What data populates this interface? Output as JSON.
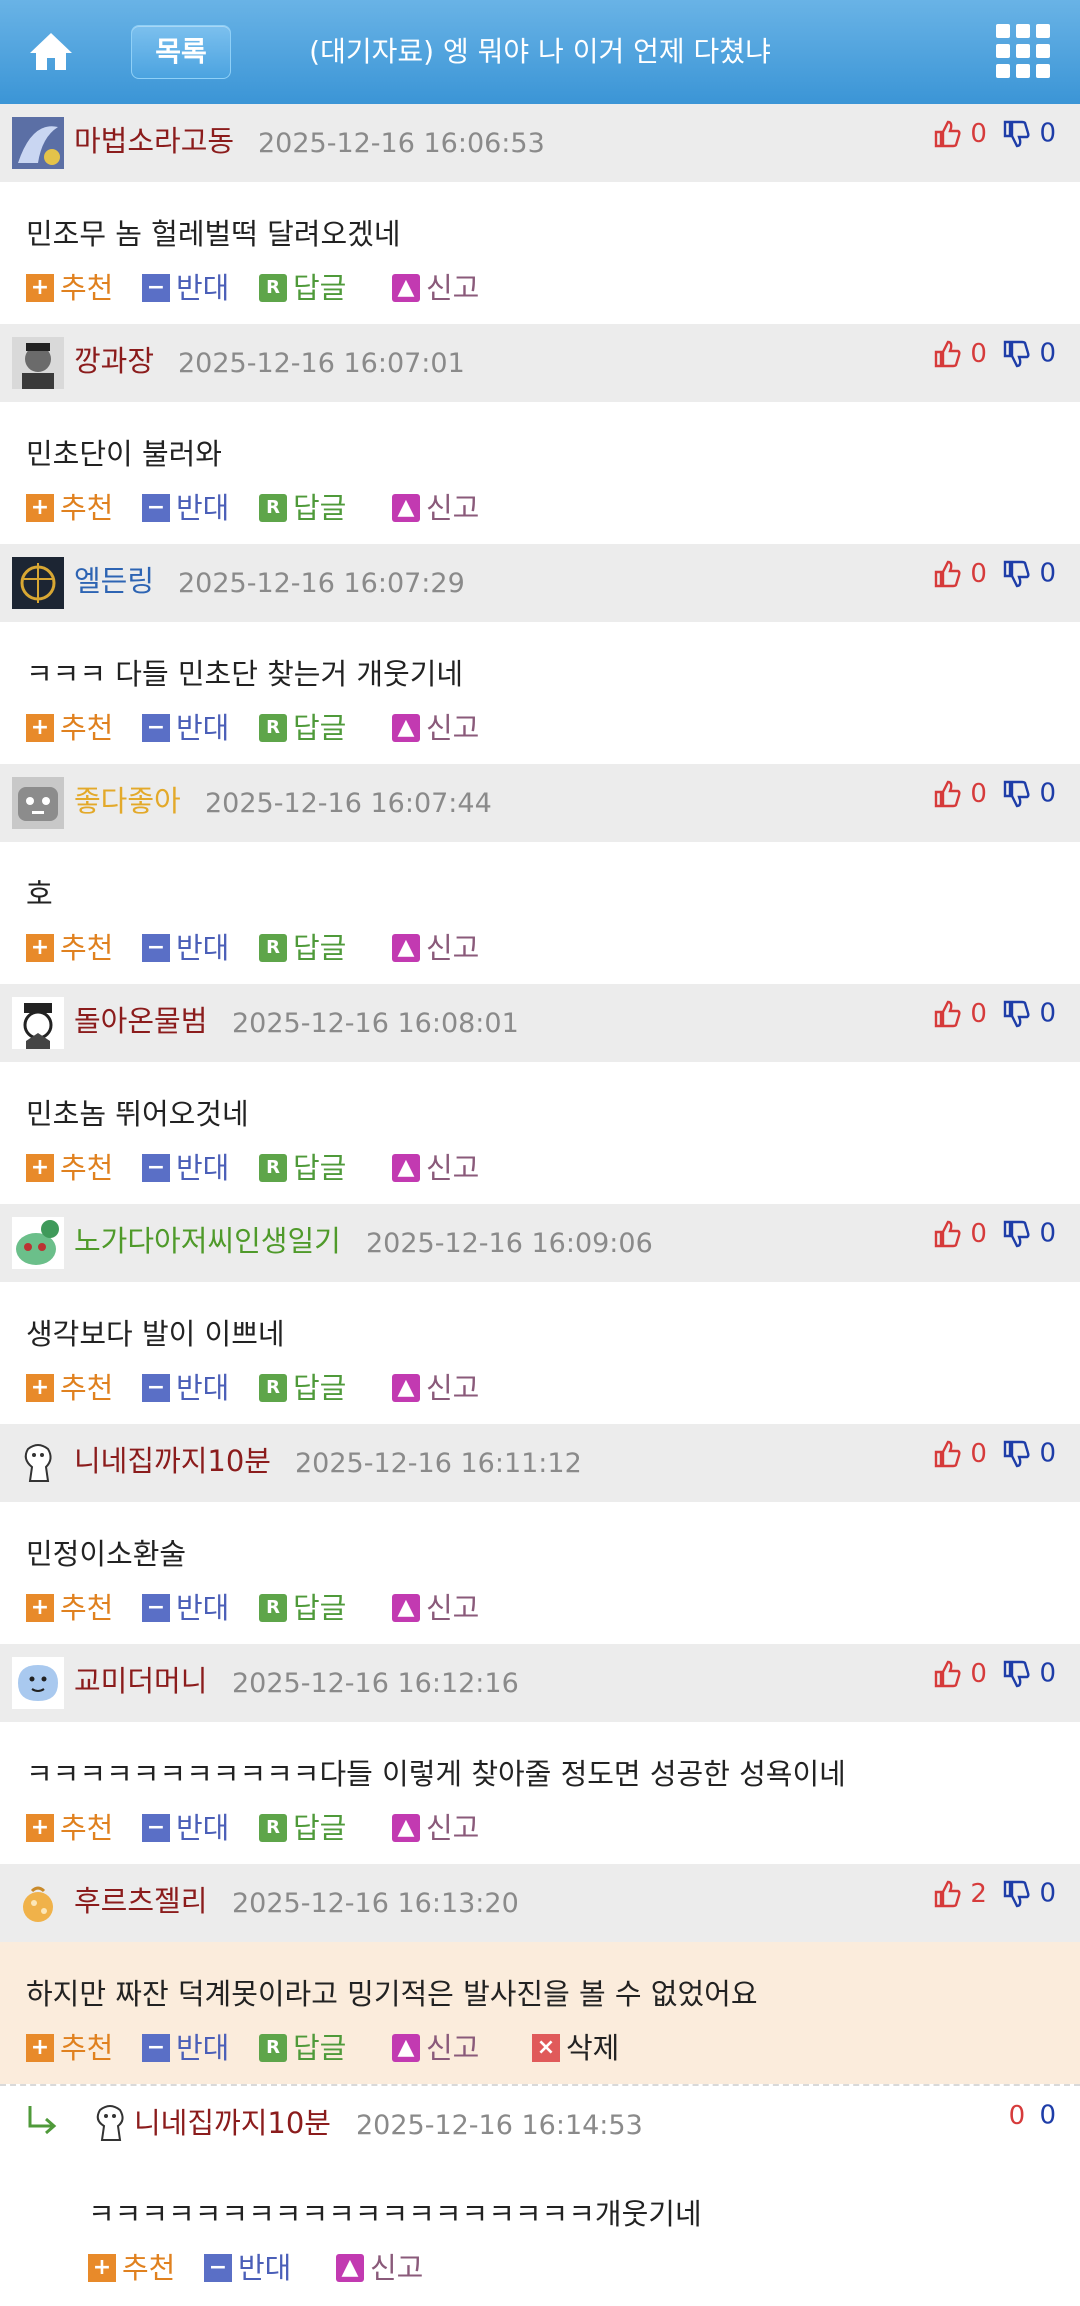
{
  "header": {
    "list_label": "목록",
    "title": "(대기자료) 엥 뭐야 나 이거 언제 다쳤냐",
    "home_icon": "home-icon",
    "menu_icon": "grid-menu-icon",
    "bar_color": "#4aa1dd"
  },
  "actions": {
    "recommend": "추천",
    "oppose": "반대",
    "reply": "답글",
    "report": "신고",
    "delete": "삭제"
  },
  "comments": [
    {
      "author": "마법소라고동",
      "author_color": "#8b1c1c",
      "time": "2025-12-16 16:06:53",
      "up": "0",
      "down": "0",
      "text": "민조무 놈 헐레벌떡 달려오겠네"
    },
    {
      "author": "깡과장",
      "author_color": "#8b1c1c",
      "time": "2025-12-16 16:07:01",
      "up": "0",
      "down": "0",
      "text": "민초단이 불러와"
    },
    {
      "author": "엘든링",
      "author_color": "#2d64b3",
      "time": "2025-12-16 16:07:29",
      "up": "0",
      "down": "0",
      "text": "ㅋㅋㅋ 다들 민초단 찾는거 개웃기네"
    },
    {
      "author": "좋다좋아",
      "author_color": "#e3a92a",
      "time": "2025-12-16 16:07:44",
      "up": "0",
      "down": "0",
      "text": "호"
    },
    {
      "author": "돌아온물범",
      "author_color": "#8b1c1c",
      "time": "2025-12-16 16:08:01",
      "up": "0",
      "down": "0",
      "text": "민초놈 뛰어오것네"
    },
    {
      "author": "노가다아저씨인생일기",
      "author_color": "#4f9a2a",
      "time": "2025-12-16 16:09:06",
      "up": "0",
      "down": "0",
      "text": "생각보다 발이 이쁘네"
    },
    {
      "author": "니네집까지10분",
      "author_color": "#8b1c1c",
      "time": "2025-12-16 16:11:12",
      "up": "0",
      "down": "0",
      "text": "민정이소환술"
    },
    {
      "author": "교미더머니",
      "author_color": "#8b1c1c",
      "time": "2025-12-16 16:12:16",
      "up": "0",
      "down": "0",
      "text": "ㅋㅋㅋㅋㅋㅋㅋㅋㅋㅋㅋ다들 이렇게 찾아줄 정도면 성공한 성욕이네"
    },
    {
      "author": "후르츠젤리",
      "author_color": "#8b1c1c",
      "time": "2025-12-16 16:13:20",
      "up": "2",
      "down": "0",
      "text": "하지만 짜잔 덕계못이라고 밍기적은 발사진을 볼 수 없었어요"
    }
  ],
  "reply": {
    "author": "니네집까지10분",
    "author_color": "#8b1c1c",
    "time": "2025-12-16 16:14:53",
    "up": "0",
    "down": "0",
    "text": "ㅋㅋㅋㅋㅋㅋㅋㅋㅋㅋㅋㅋㅋㅋㅋㅋㅋㅋㅋ개웃기네"
  }
}
